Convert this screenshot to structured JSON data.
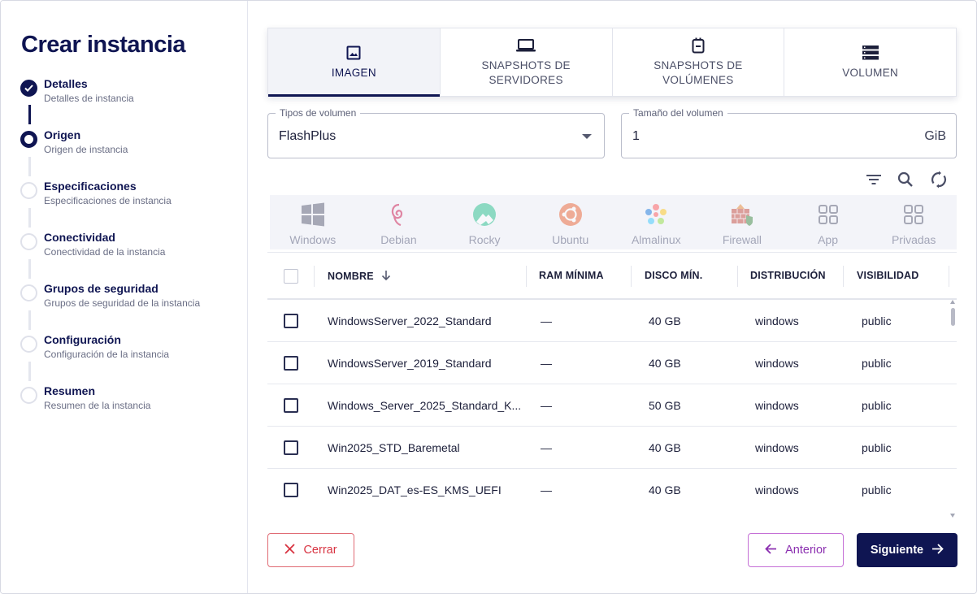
{
  "sidebar": {
    "title": "Crear instancia",
    "steps": [
      {
        "label": "Detalles",
        "sub": "Detalles de instancia",
        "state": "done"
      },
      {
        "label": "Origen",
        "sub": "Origen de instancia",
        "state": "active"
      },
      {
        "label": "Especificaciones",
        "sub": "Especificaciones de instancia",
        "state": "pending"
      },
      {
        "label": "Conectividad",
        "sub": "Conectividad de la instancia",
        "state": "pending"
      },
      {
        "label": "Grupos de seguridad",
        "sub": "Grupos de seguridad de la instancia",
        "state": "pending"
      },
      {
        "label": "Configuración",
        "sub": "Configuración de la instancia",
        "state": "pending"
      },
      {
        "label": "Resumen",
        "sub": "Resumen de la instancia",
        "state": "pending"
      }
    ]
  },
  "tabs": [
    {
      "line1": "IMAGEN",
      "line2": "",
      "icon": "image-icon",
      "active": true
    },
    {
      "line1": "SNAPSHOTS DE",
      "line2": "SERVIDORES",
      "icon": "laptop-icon",
      "active": false
    },
    {
      "line1": "SNAPSHOTS DE",
      "line2": "VOLÚMENES",
      "icon": "drive-icon",
      "active": false
    },
    {
      "line1": "VOLUMEN",
      "line2": "",
      "icon": "storage-list-icon",
      "active": false
    }
  ],
  "fields": {
    "volume_type": {
      "legend": "Tipos de volumen",
      "value": "FlashPlus"
    },
    "volume_size": {
      "legend": "Tamaño del volumen",
      "value": "1",
      "unit": "GiB"
    }
  },
  "toolbar": {
    "icons": [
      "filter-icon",
      "search-icon",
      "refresh-icon"
    ]
  },
  "distros": [
    {
      "label": "Windows",
      "icon": "windows-icon"
    },
    {
      "label": "Debian",
      "icon": "debian-icon"
    },
    {
      "label": "Rocky",
      "icon": "rocky-icon"
    },
    {
      "label": "Ubuntu",
      "icon": "ubuntu-icon"
    },
    {
      "label": "Almalinux",
      "icon": "almalinux-icon"
    },
    {
      "label": "Firewall",
      "icon": "firewall-icon"
    },
    {
      "label": "App",
      "icon": "apps-grid-icon"
    },
    {
      "label": "Privadas",
      "icon": "apps-grid-icon"
    }
  ],
  "table": {
    "columns": [
      "NOMBRE",
      "RAM MÍNIMA",
      "DISCO MÍN.",
      "DISTRIBUCIÓN",
      "VISIBILIDAD"
    ],
    "rows": [
      {
        "name": "WindowsServer_2022_Standard",
        "ram": "—",
        "disk": "40 GB",
        "distro": "windows",
        "visibility": "public"
      },
      {
        "name": "WindowsServer_2019_Standard",
        "ram": "—",
        "disk": "40 GB",
        "distro": "windows",
        "visibility": "public"
      },
      {
        "name": "Windows_Server_2025_Standard_K...",
        "ram": "—",
        "disk": "50 GB",
        "distro": "windows",
        "visibility": "public"
      },
      {
        "name": "Win2025_STD_Baremetal",
        "ram": "—",
        "disk": "40 GB",
        "distro": "windows",
        "visibility": "public"
      },
      {
        "name": "Win2025_DAT_es-ES_KMS_UEFI",
        "ram": "—",
        "disk": "40 GB",
        "distro": "windows",
        "visibility": "public"
      }
    ]
  },
  "buttons": {
    "close": "Cerrar",
    "previous": "Anterior",
    "next": "Siguiente"
  },
  "colors": {
    "primary": "#0f1552",
    "danger": "#d83341",
    "secondary": "#8b2fb0"
  }
}
